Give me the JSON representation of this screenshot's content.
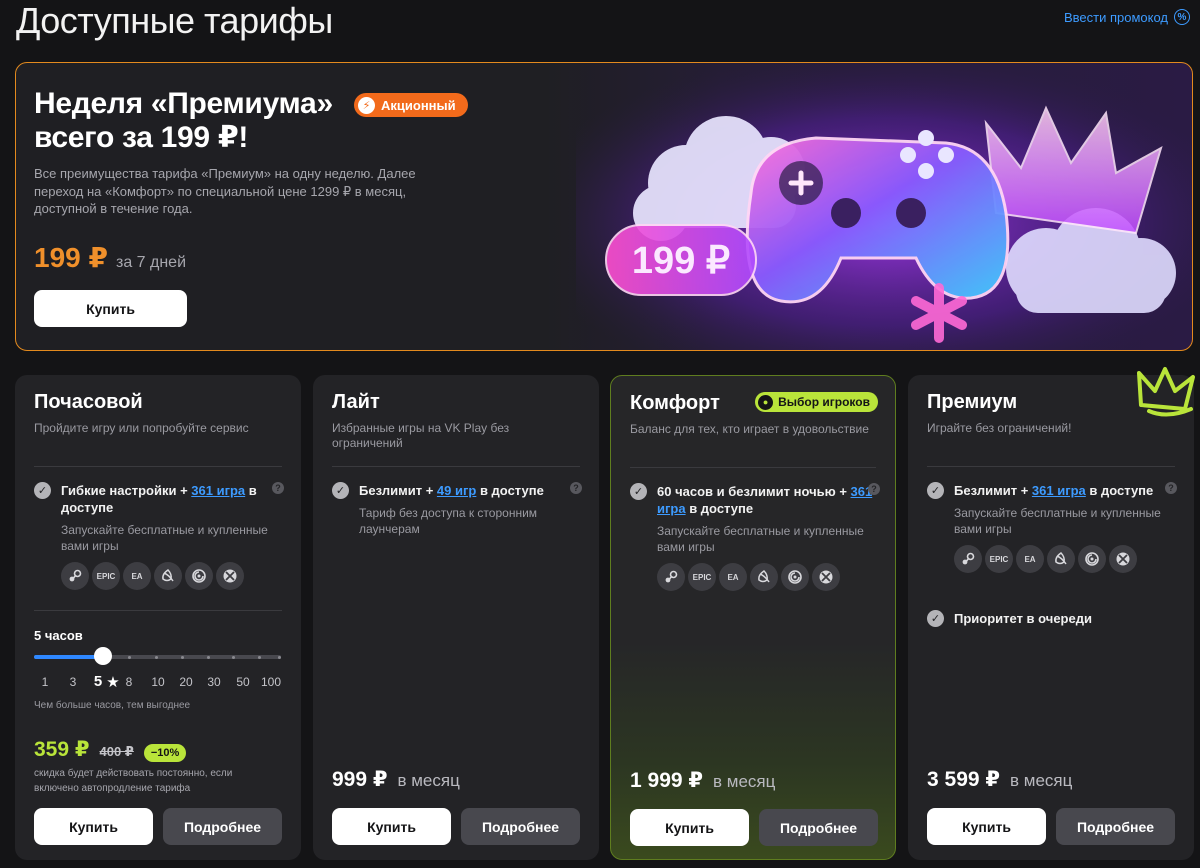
{
  "header": {
    "title": "Доступные тарифы",
    "promo_link": "Ввести промокод",
    "promo_icon": "percent-icon"
  },
  "banner": {
    "title": "Неделя «Премиума» всего за 199 ₽!",
    "badge": "Акционный",
    "description": "Все преимущества тарифа «Премиум» на одну неделю. Далее переход на «Комфорт» по специальной цене 1299 ₽ в месяц, доступной в течение года.",
    "price": "199 ₽",
    "period": "за 7 дней",
    "buy_label": "Купить",
    "art_price": "199 ₽",
    "accent": "#e38a1e"
  },
  "plans": [
    {
      "name": "Почасовой",
      "subtitle": "Пройдите игру или попробуйте сервис",
      "feature_pre": "Гибкие настройки + ",
      "feature_link": "361 игра",
      "feature_post": " в доступе",
      "feature_note": "Запускайте бесплатные и купленные вами игры",
      "launchers": [
        "steam-icon",
        "epic-games-icon",
        "ea-icon",
        "battlenet-icon",
        "ubisoft-icon",
        "xbox-icon"
      ],
      "hours_label": "5 часов",
      "slider_ticks": [
        "1",
        "3",
        "5",
        "8",
        "10",
        "20",
        "30",
        "50",
        "100"
      ],
      "slider_selected": "5",
      "slider_note": "Чем больше часов, тем выгоднее",
      "price": "359 ₽",
      "old_price": "400 ₽",
      "discount": "−10%",
      "discount_note": "скидка будет действовать постоянно, если включено автопродление тарифа",
      "buy_label": "Купить",
      "more_label": "Подробнее"
    },
    {
      "name": "Лайт",
      "subtitle": "Избранные игры на VK Play без ограничений",
      "feature_pre": "Безлимит + ",
      "feature_link": "49 игр",
      "feature_post": " в доступе",
      "feature_note": "Тариф без доступа к сторонним лаунчерам",
      "price": "999 ₽",
      "period": "в месяц",
      "buy_label": "Купить",
      "more_label": "Подробнее"
    },
    {
      "name": "Комфорт",
      "badge": "Выбор игроков",
      "subtitle": "Баланс для тех, кто играет в удовольствие",
      "feature_pre": "60 часов и безлимит ночью + ",
      "feature_link": "361 игра",
      "feature_post": " в доступе",
      "feature_note": "Запускайте бесплатные и купленные вами игры",
      "launchers": [
        "steam-icon",
        "epic-games-icon",
        "ea-icon",
        "battlenet-icon",
        "ubisoft-icon",
        "xbox-icon"
      ],
      "price": "1 999 ₽",
      "period": "в месяц",
      "buy_label": "Купить",
      "more_label": "Подробнее",
      "accent": "#b9e43a"
    },
    {
      "name": "Премиум",
      "subtitle": "Играйте без ограничений!",
      "feature_pre": "Безлимит + ",
      "feature_link": "361 игра",
      "feature_post": " в доступе",
      "feature_note": "Запускайте бесплатные и купленные вами игры",
      "launchers": [
        "steam-icon",
        "epic-games-icon",
        "ea-icon",
        "battlenet-icon",
        "ubisoft-icon",
        "xbox-icon"
      ],
      "feature2": "Приоритет в очереди",
      "price": "3 599 ₽",
      "period": "в месяц",
      "buy_label": "Купить",
      "more_label": "Подробнее"
    }
  ],
  "slider_value": 5,
  "launcher_texts": {
    "epic": "EPIC",
    "ea": "EA"
  }
}
